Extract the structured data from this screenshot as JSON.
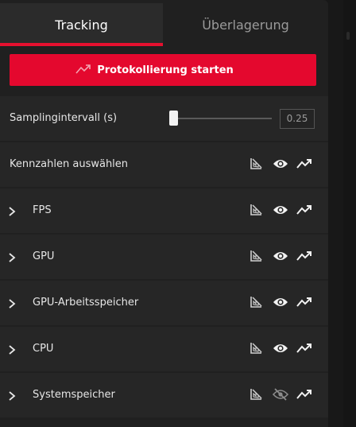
{
  "tabs": [
    {
      "label": "Tracking",
      "active": true
    },
    {
      "label": "Überlagerung",
      "active": false
    }
  ],
  "start_button": {
    "label": "Protokollierung starten",
    "icon": "trend-up-icon"
  },
  "sampling": {
    "label": "Samplingintervall (s)",
    "value": "0.25",
    "slider_fraction": 0.0
  },
  "metrics_header": {
    "label": "Kennzahlen auswählen"
  },
  "metrics": [
    {
      "label": "FPS",
      "visible": true
    },
    {
      "label": "GPU",
      "visible": true
    },
    {
      "label": "GPU-Arbeitsspeicher",
      "visible": true
    },
    {
      "label": "CPU",
      "visible": true
    },
    {
      "label": "Systemspeicher",
      "visible": false
    }
  ],
  "colors": {
    "accent": "#e4082e",
    "panel": "#202020",
    "row": "#262626",
    "text": "#e6e6e6",
    "muted": "#9a9a9a"
  }
}
